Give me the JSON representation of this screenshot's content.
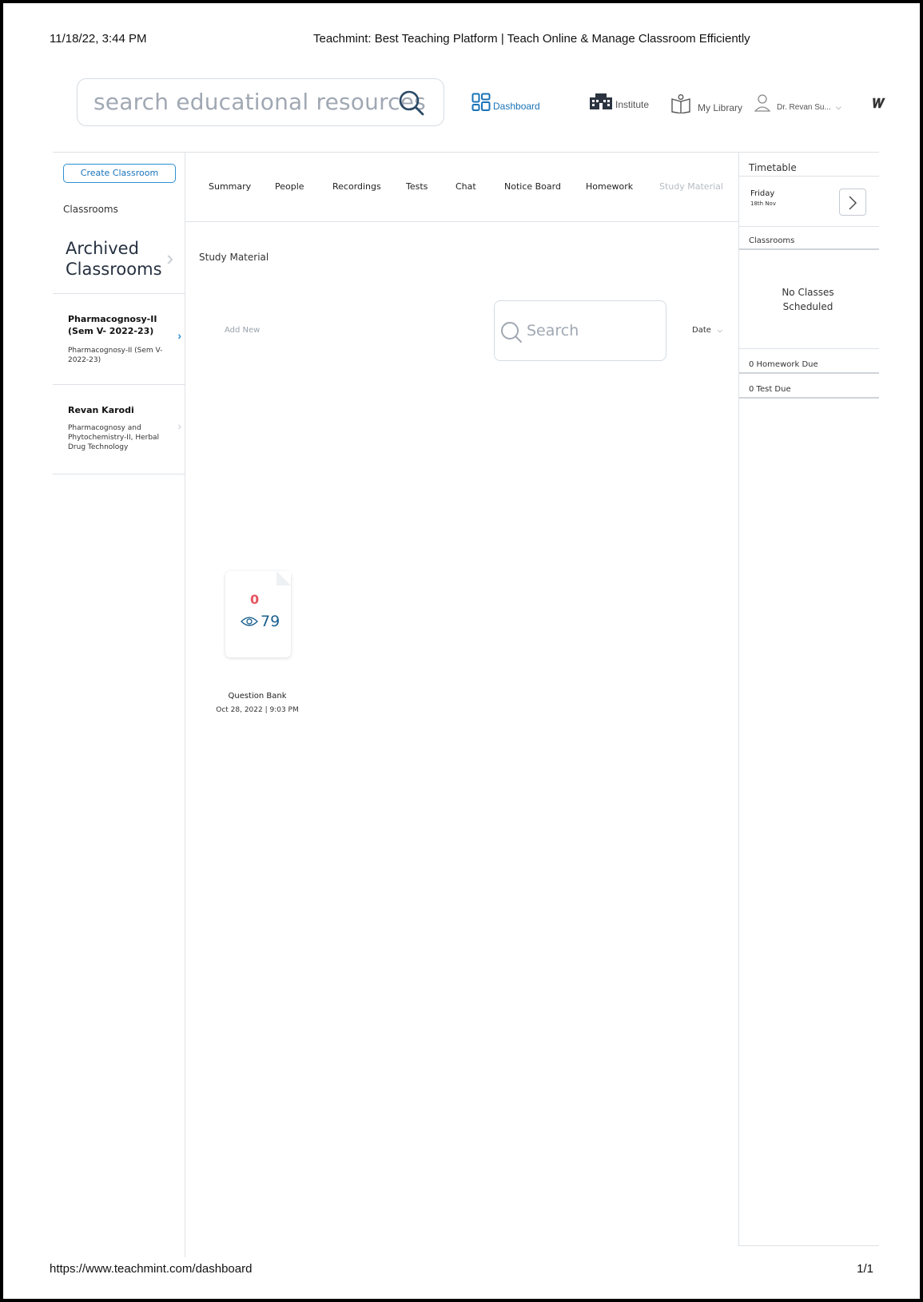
{
  "print": {
    "datetime": "11/18/22, 3:44 PM",
    "title": "Teachmint: Best Teaching Platform | Teach Online & Manage Classroom Efficiently",
    "url": "https://www.teachmint.com/dashboard",
    "page": "1/1"
  },
  "topbar": {
    "search_placeholder": "search educational resources",
    "nav": {
      "dashboard": "Dashboard",
      "institute": "Institute",
      "library": "My Library",
      "user": "Dr. Revan Su...",
      "bell_glyph": "⌂"
    }
  },
  "sidebar": {
    "create_button": "Create Classroom",
    "heading": "Classrooms",
    "archived": "Archived Classrooms",
    "classes": [
      {
        "name": "Pharmacognosy-II (Sem V- 2022-23)",
        "subtitle": "Pharmacognosy-II (Sem V- 2022-23)"
      },
      {
        "name": "Revan Karodi",
        "subtitle": "Pharmacognosy and Phytochemistry-II, Herbal Drug Technology"
      }
    ]
  },
  "tabs": [
    "Summary",
    "People",
    "Recordings",
    "Tests",
    "Chat",
    "Notice Board",
    "Homework",
    "Study Material"
  ],
  "main": {
    "section_title": "Study Material",
    "add_new": "Add New",
    "search_placeholder": "Search",
    "sort_label": "Date",
    "files": [
      {
        "badge": "0",
        "views": "79",
        "name": "Question Bank",
        "date": "Oct 28, 2022 | 9:03 PM"
      }
    ]
  },
  "right_panel": {
    "timetable_title": "Timetable",
    "day": "Friday",
    "date": "18th Nov",
    "classrooms_label": "Classrooms",
    "no_classes": "No Classes Scheduled",
    "homework_due": "0 Homework Due",
    "test_due": "0 Test Due"
  },
  "colors": {
    "accent": "#1a73b8",
    "badge": "#e65561",
    "border": "#dde2e7"
  }
}
